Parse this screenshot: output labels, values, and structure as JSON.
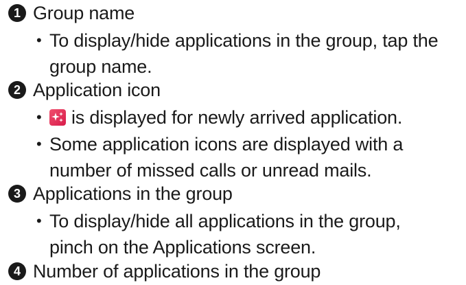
{
  "items": [
    {
      "number": "1",
      "title": "Group name",
      "bullets": [
        {
          "lines": [
            "To display/hide applications in the group, tap the",
            "group name."
          ]
        }
      ]
    },
    {
      "number": "2",
      "title": "Application icon",
      "bullets": [
        {
          "icon": "new-application-badge-icon",
          "lines": [
            "is displayed for newly arrived application."
          ]
        },
        {
          "lines": [
            "Some application icons are displayed with a",
            "number of missed calls or unread mails."
          ]
        }
      ]
    },
    {
      "number": "3",
      "title": "Applications in the group",
      "bullets": [
        {
          "lines": [
            "To display/hide all applications in the group,",
            "pinch on the Applications screen."
          ]
        }
      ]
    },
    {
      "number": "4",
      "title": "Number of applications in the group",
      "bullets": []
    }
  ],
  "bullet_symbol": "•",
  "colors": {
    "text": "#1a1a1a",
    "number_circle": "#1a1a1a",
    "new_icon": "#e0345c"
  }
}
